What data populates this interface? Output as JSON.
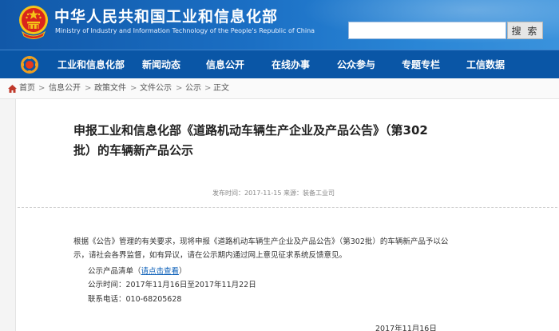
{
  "site": {
    "title": "中华人民共和国工业和信息化部",
    "subtitle": "Ministry of Industry and Information Technology of the People's Republic of China"
  },
  "search": {
    "value": "",
    "button_label": "搜 索"
  },
  "nav": {
    "items": [
      {
        "label": "工业和信息化部"
      },
      {
        "label": "新闻动态"
      },
      {
        "label": "信息公开"
      },
      {
        "label": "在线办事"
      },
      {
        "label": "公众参与"
      },
      {
        "label": "专题专栏"
      },
      {
        "label": "工信数据"
      }
    ]
  },
  "breadcrumb": {
    "items": [
      {
        "label": "首页"
      },
      {
        "label": "信息公开"
      },
      {
        "label": "政策文件"
      },
      {
        "label": "文件公示"
      },
      {
        "label": "公示"
      },
      {
        "label": "正文"
      }
    ],
    "separator": ">"
  },
  "article": {
    "title_line1": "申报工业和信息化部《道路机动车辆生产企业及产品公告》（第302",
    "title_line2": "批）的车辆新产品公示",
    "meta": "发布时间：2017-11-15  来源：装备工业司",
    "para_line1": "根据《公告》管理的有关要求，现将申报《道路机动车辆生产企业及产品公告》（第302批）的车辆新产品予以公",
    "para_line2": "示，请社会各界监督，如有异议，请在公示期内通过网上意见征求系统反馈意见。",
    "list_label": "公示产品清单（",
    "list_link": "请点击查看",
    "list_close": "）",
    "period": "公示时间：2017年11月16日至2017年11月22日",
    "phone": "联系电话：010-68205628",
    "sign_date": "2017年11月16日"
  },
  "colors": {
    "header_blue": "#1b6fc4",
    "nav_blue": "#0a56a6",
    "link_blue": "#0b5fb8",
    "emblem_red": "#d9261c",
    "emblem_gold": "#f5c518"
  }
}
